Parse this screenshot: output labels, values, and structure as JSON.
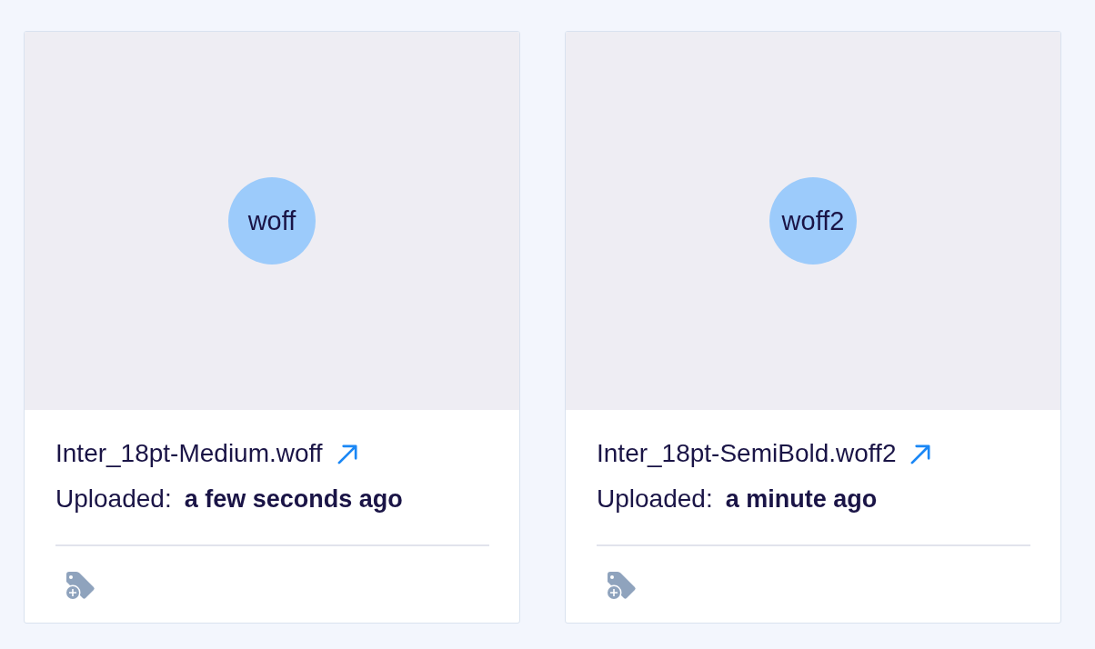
{
  "files": [
    {
      "format": "woff",
      "name": "Inter_18pt-Medium.woff",
      "uploaded_label": "Uploaded:",
      "uploaded_value": "a few seconds ago"
    },
    {
      "format": "woff2",
      "name": "Inter_18pt-SemiBold.woff2",
      "uploaded_label": "Uploaded:",
      "uploaded_value": "a minute ago"
    }
  ]
}
